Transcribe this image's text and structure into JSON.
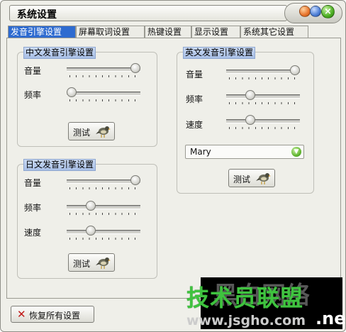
{
  "window": {
    "title": "系统设置",
    "title_button_glyph": "×"
  },
  "tabs": [
    {
      "label": "发音引擎设置",
      "active": true
    },
    {
      "label": "屏幕取词设置",
      "active": false
    },
    {
      "label": "热键设置",
      "active": false
    },
    {
      "label": "显示设置",
      "active": false
    },
    {
      "label": "系统其它设置",
      "active": false
    }
  ],
  "chinese_engine": {
    "title": "中文发音引擎设置",
    "volume_label": "音量",
    "volume_level": 1.0,
    "rate_label": "频率",
    "rate_level": 0.0,
    "test_label": "测试"
  },
  "japanese_engine": {
    "title": "日文发音引擎设置",
    "volume_label": "音量",
    "volume_level": 1.0,
    "rate_label": "频率",
    "rate_level": 0.3,
    "speed_label": "速度",
    "speed_level": 0.3,
    "test_label": "测试"
  },
  "english_engine": {
    "title": "英文发音引擎设置",
    "volume_label": "音量",
    "volume_level": 1.0,
    "rate_label": "频率",
    "rate_level": 0.3,
    "speed_label": "速度",
    "speed_level": 0.3,
    "voice_value": "Mary",
    "test_label": "测试"
  },
  "footer": {
    "restore_label": "恢复所有设置"
  },
  "watermark": {
    "cn_text": "技术员联盟",
    "overlay_text": "黑白网络",
    "url_text": "www.jsgho.com",
    "url_suffix": ".net"
  },
  "colors": {
    "active_tab": "#2e6bd0",
    "group_title_bg": "#a8bfe6",
    "window_bg": "#efefe9",
    "watermark_green": "#3fc33f"
  }
}
